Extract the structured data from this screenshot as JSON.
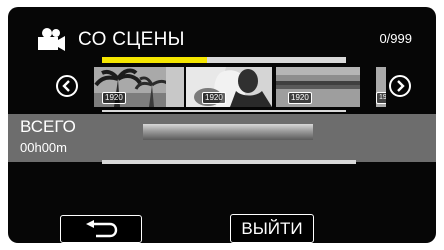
{
  "header": {
    "icon": "movie-camera-icon",
    "title": "СО СЦЕНЫ",
    "counter": "0/999",
    "progress_fraction": 0.43
  },
  "accent_color": "#f5e600",
  "thumbnails": [
    {
      "label": "1920"
    },
    {
      "label": "1920"
    },
    {
      "label": "1920"
    },
    {
      "label": "19"
    }
  ],
  "nav": {
    "prev_icon": "chevron-left-icon",
    "next_icon": "chevron-right-icon"
  },
  "summary": {
    "label": "ВСЕГО",
    "time": "00h00m"
  },
  "footer": {
    "back_icon": "return-arrow-icon",
    "exit_label": "ВЫЙТИ"
  }
}
